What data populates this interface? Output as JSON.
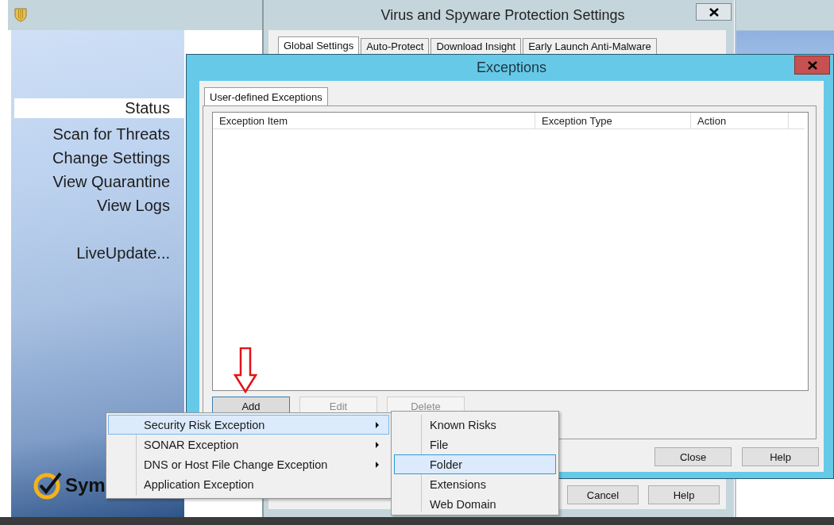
{
  "main_window": {
    "nav": [
      {
        "label": "Status",
        "selected": true
      },
      {
        "label": "Scan for Threats",
        "selected": false
      },
      {
        "label": "Change Settings",
        "selected": false
      },
      {
        "label": "View Quarantine",
        "selected": false
      },
      {
        "label": "View Logs",
        "selected": false
      }
    ],
    "live_update": "LiveUpdate...",
    "logo_text": "Sym"
  },
  "settings_dialog": {
    "title": "Virus and Spyware Protection Settings",
    "tabs": [
      {
        "label": "Global Settings",
        "selected": true
      },
      {
        "label": "Auto-Protect",
        "selected": false
      },
      {
        "label": "Download Insight",
        "selected": false
      },
      {
        "label": "Early Launch Anti-Malware",
        "selected": false
      }
    ],
    "buttons": [
      "Cancel",
      "Help"
    ]
  },
  "exceptions_dialog": {
    "title": "Exceptions",
    "tabs": [
      {
        "label": "User-defined Exceptions",
        "selected": true
      }
    ],
    "table": {
      "columns": [
        "Exception Item",
        "Exception Type",
        "Action"
      ]
    },
    "list_buttons": [
      {
        "label": "Add",
        "disabled": false
      },
      {
        "label": "Edit",
        "disabled": true
      },
      {
        "label": "Delete",
        "disabled": true
      }
    ],
    "buttons": [
      "Close",
      "Help"
    ]
  },
  "context_menu": {
    "items": [
      {
        "label": "Security Risk Exception",
        "has_submenu": true,
        "selected": true
      },
      {
        "label": "SONAR Exception",
        "has_submenu": true,
        "selected": false
      },
      {
        "label": "DNS or Host File Change Exception",
        "has_submenu": true,
        "selected": false
      },
      {
        "label": "Application Exception",
        "has_submenu": false,
        "selected": false
      }
    ]
  },
  "submenu": {
    "items": [
      {
        "label": "Known Risks",
        "selected": false
      },
      {
        "label": "File",
        "selected": false
      },
      {
        "label": "Folder",
        "selected": true
      },
      {
        "label": "Extensions",
        "selected": false
      },
      {
        "label": "Web Domain",
        "selected": false
      }
    ]
  }
}
